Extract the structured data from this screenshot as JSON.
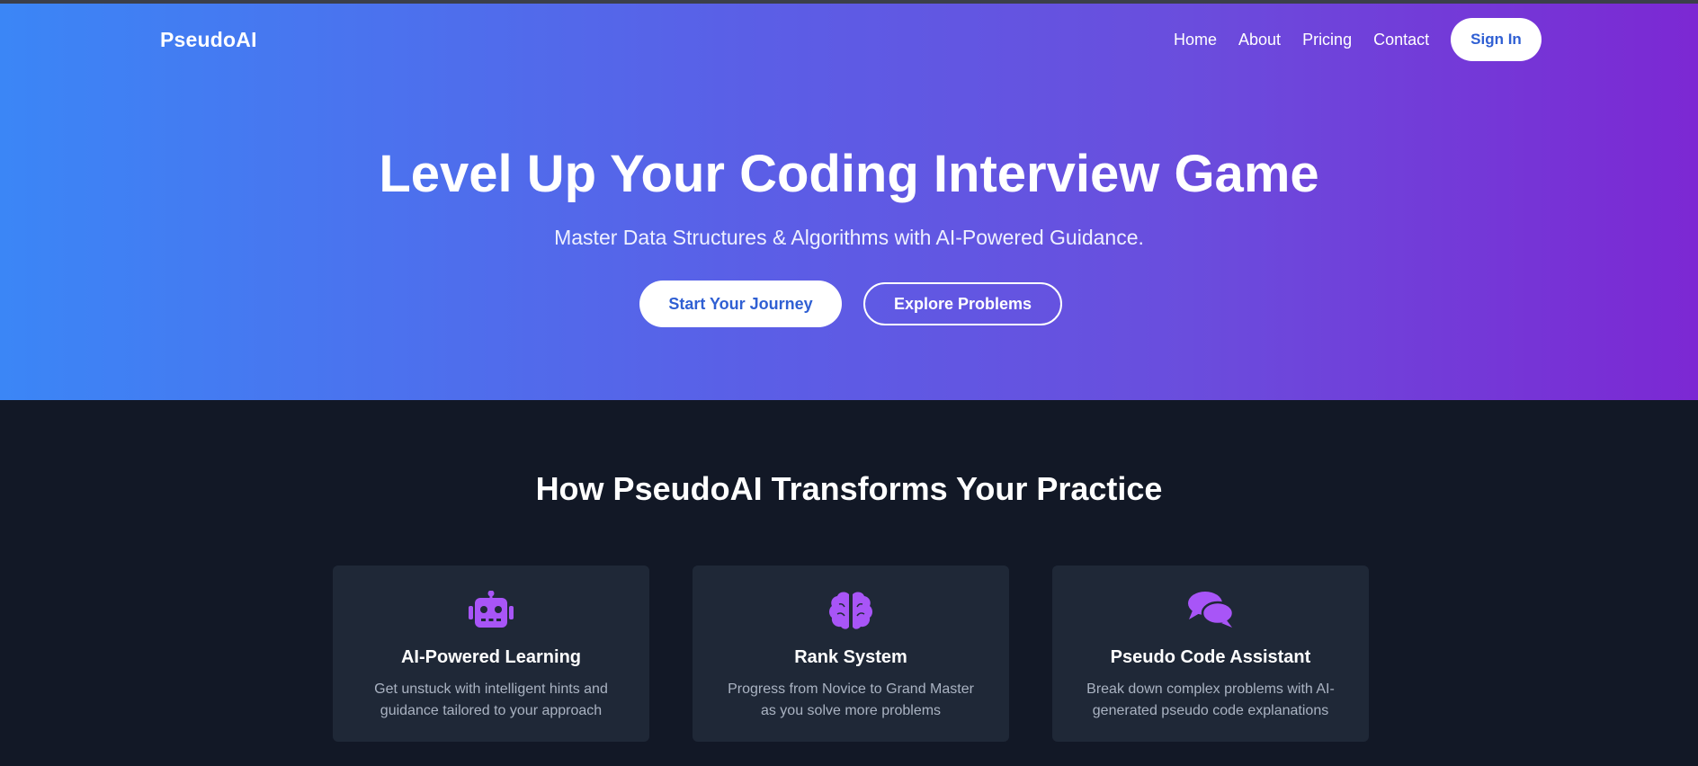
{
  "nav": {
    "logo": "PseudoAI",
    "links": [
      "Home",
      "About",
      "Pricing",
      "Contact"
    ],
    "sign_in": "Sign In"
  },
  "hero": {
    "title": "Level Up Your Coding Interview Game",
    "subtitle": "Master Data Structures & Algorithms with AI-Powered Guidance.",
    "primary_button": "Start Your Journey",
    "secondary_button": "Explore Problems"
  },
  "features": {
    "title": "How PseudoAI Transforms Your Practice",
    "cards": [
      {
        "icon": "robot-icon",
        "title": "AI-Powered Learning",
        "description": "Get unstuck with intelligent hints and guidance tailored to your approach"
      },
      {
        "icon": "brain-icon",
        "title": "Rank System",
        "description": "Progress from Novice to Grand Master as you solve more problems"
      },
      {
        "icon": "chat-bubbles-icon",
        "title": "Pseudo Code Assistant",
        "description": "Break down complex problems with AI-generated pseudo code explanations"
      }
    ]
  },
  "colors": {
    "accent_purple": "#a855f7",
    "gradient_start": "#3b86f6",
    "gradient_end": "#7c28d3",
    "dark_background": "#121826",
    "card_background": "#1f2837"
  }
}
